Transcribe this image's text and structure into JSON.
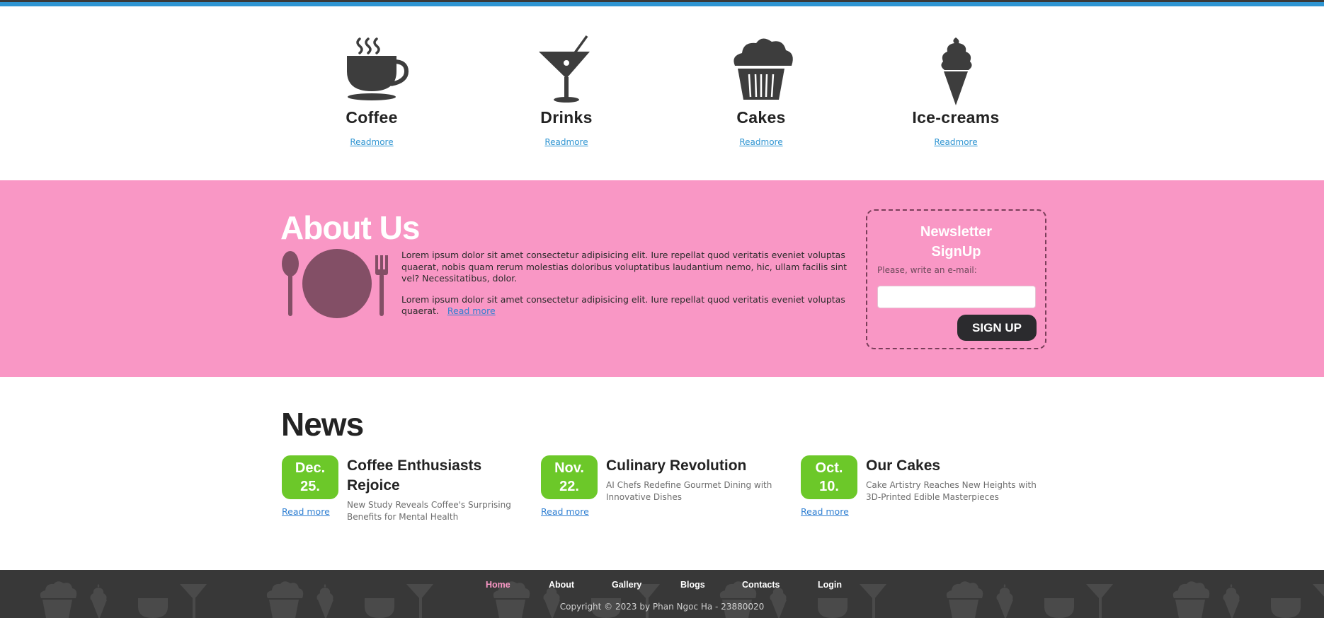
{
  "categories": [
    {
      "name": "Coffee",
      "link": "Readmore",
      "icon": "coffee-cup-icon"
    },
    {
      "name": "Drinks",
      "link": "Readmore",
      "icon": "cocktail-icon"
    },
    {
      "name": "Cakes",
      "link": "Readmore",
      "icon": "cupcake-icon"
    },
    {
      "name": "Ice-creams",
      "link": "Readmore",
      "icon": "ice-cream-icon"
    }
  ],
  "about": {
    "title": "About Us",
    "icon": "plate-cutlery-icon",
    "paragraph1": "Lorem ipsum dolor sit amet consectetur adipisicing elit. Iure repellat quod veritatis eveniet voluptas quaerat, nobis quam rerum molestias doloribus voluptatibus laudantium nemo, hic, ullam facilis sint vel? Necessitatibus, dolor.",
    "paragraph2": "Lorem ipsum dolor sit amet consectetur adipisicing elit. Iure repellat quod veritatis eveniet voluptas quaerat.",
    "read_more": "Read more"
  },
  "newsletter": {
    "title": "Newsletter SignUp",
    "label": "Please, write an e-mail:",
    "input_value": "",
    "button": "SIGN UP"
  },
  "news": {
    "title": "News",
    "items": [
      {
        "month": "Dec.",
        "day": "25.",
        "headline": "Coffee Enthusiasts Rejoice",
        "desc": "New Study Reveals Coffee's Surprising Benefits for Mental Health",
        "read_more": "Read more"
      },
      {
        "month": "Nov.",
        "day": "22.",
        "headline": "Culinary Revolution",
        "desc": "AI Chefs Redefine Gourmet Dining with Innovative Dishes",
        "read_more": "Read more"
      },
      {
        "month": "Oct.",
        "day": "10.",
        "headline": "Our Cakes",
        "desc": "Cake Artistry Reaches New Heights with 3D-Printed Edible Masterpieces",
        "read_more": "Read more"
      }
    ]
  },
  "footer": {
    "nav": [
      {
        "label": "Home",
        "active": true
      },
      {
        "label": "About",
        "active": false
      },
      {
        "label": "Gallery",
        "active": false
      },
      {
        "label": "Blogs",
        "active": false
      },
      {
        "label": "Contacts",
        "active": false
      },
      {
        "label": "Login",
        "active": false
      }
    ],
    "copyright": "Copyright © 2023 by Phan Ngoc Ha - 23880020"
  },
  "colors": {
    "accent_blue": "#2f95d2",
    "pink": "#f997c5",
    "green": "#6cc829",
    "dark": "#232323",
    "footer_bg": "#383838"
  }
}
